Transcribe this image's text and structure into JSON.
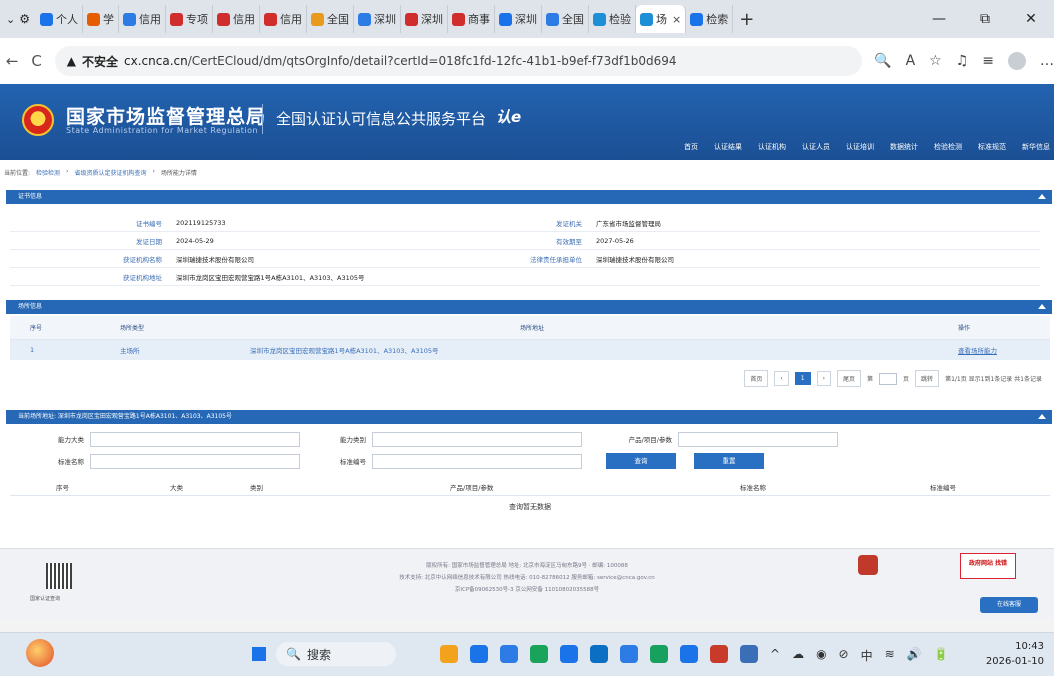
{
  "browser": {
    "tabs": [
      {
        "label": "个人",
        "color": "#1a73e8"
      },
      {
        "label": "学",
        "color": "#e65c00"
      },
      {
        "label": "信用",
        "color": "#2d7be5"
      },
      {
        "label": "专项",
        "color": "#d02d2d"
      },
      {
        "label": "信用",
        "color": "#d02d2d"
      },
      {
        "label": "信用",
        "color": "#d02d2d"
      },
      {
        "label": "全国",
        "color": "#e89a1c"
      },
      {
        "label": "深圳",
        "color": "#2d7be5"
      },
      {
        "label": "深圳",
        "color": "#d02d2d"
      },
      {
        "label": "商事",
        "color": "#d02d2d"
      },
      {
        "label": "深圳",
        "color": "#1a73e8"
      },
      {
        "label": "全国",
        "color": "#2d7be5"
      },
      {
        "label": "检验",
        "color": "#1c8fd6"
      },
      {
        "label": "场",
        "color": "#1c8fd6",
        "active": true
      },
      {
        "label": "检索",
        "color": "#1a73e8"
      }
    ],
    "tab_close": "×",
    "new_tab": "+",
    "window_controls": {
      "minimize": "—",
      "restore": "⧉",
      "close": "✕"
    },
    "back": "←",
    "reload": "C",
    "insecure_label": "不安全",
    "url_host": "cx.cnca.cn",
    "url_path": "/CertECloud/dm/qtsOrgInfo/detail?certId=018fc1fd-12fc-41b1-b9ef-f73df1b0d694",
    "toolbar_icons": [
      "zoom-icon",
      "read-aloud-icon",
      "favorite-icon",
      "extensions-icon",
      "collections-icon",
      "profile-icon",
      "more-icon"
    ],
    "toolbar_glyphs": [
      "🔍",
      "A",
      "☆",
      "♫",
      "≡",
      "",
      "…"
    ]
  },
  "site": {
    "name": "国家市场监督管理总局",
    "name_en": "State Administration for Market Regulation",
    "platform": "全国认证认可信息公共服务平台",
    "platform_logo": "认e",
    "nav": [
      "首页",
      "认证结果",
      "认证机构",
      "认证人员",
      "认证培训",
      "数据统计",
      "检验检测",
      "标准规范",
      "新华信息"
    ]
  },
  "breadcrumb": {
    "prefix": "当前位置:",
    "items": [
      "检验检测",
      "省级资质认定获证机构查询",
      "场所能力详情"
    ]
  },
  "cert_section": {
    "title": "证书信息",
    "rows": [
      {
        "l1": "证书编号",
        "v1": "202119125733",
        "l2": "发证机关",
        "v2": "广东省市场监督管理局"
      },
      {
        "l1": "发证日期",
        "v1": "2024-05-29",
        "l2": "有效期至",
        "v2": "2027-05-26"
      },
      {
        "l1": "获证机构名称",
        "v1": "深圳瑞捷技术股份有限公司",
        "l2": "法律责任承担单位",
        "v2": "深圳瑞捷技术股份有限公司"
      },
      {
        "l1": "获证机构地址",
        "v1": "深圳市龙岗区宝田宏观营宝路1号A栋A3101、A3103、A3105号",
        "l2": "",
        "v2": ""
      }
    ]
  },
  "site_section": {
    "title": "场所信息",
    "headers": {
      "no": "序号",
      "type": "场所类型",
      "addr": "场所地址",
      "op": "操作"
    },
    "rows": [
      {
        "no": "1",
        "type": "主场所",
        "addr": "深圳市龙岗区宝田宏观营宝路1号A栋A3101、A3103、A3105号",
        "op": "查看场所能力"
      }
    ]
  },
  "pager": {
    "first": "首页",
    "prev": "‹",
    "current": "1",
    "next": "›",
    "last": "尾页",
    "goto_prefix": "第",
    "goto_suffix": "页",
    "jump": "跳转",
    "info": "第1/1页 显示1到1条记录 共1条记录"
  },
  "cap_section": {
    "title": "当前场所地址: 深圳市龙岗区宝田宏观营宝路1号A栋A3101、A3103、A3105号",
    "labels": {
      "cap_major": "能力大类",
      "cap_class": "能力类别",
      "product": "产品/项目/参数",
      "std_name": "标准名称",
      "std_no": "标准编号"
    },
    "buttons": {
      "search": "查询",
      "reset": "重置"
    },
    "headers": {
      "no": "序号",
      "major": "大类",
      "class": "类别",
      "product": "产品/项目/参数",
      "std_name": "标准名称",
      "std_no": "标准编号"
    },
    "empty": "查询暂无数据"
  },
  "footer": {
    "qr_label": "国家认证查询",
    "line1": "版权所有: 国家市场监督管理总局  地址: 北京市海淀区马甸东路9号 · 邮编: 100088",
    "line2": "技术支持: 北京中认网络信息技术有限公司  热线电话: 010-82786012  服务邮箱: service@cnca.gov.cn",
    "line3": "京ICP备09062530号-3  京公网安备 11010802035588号",
    "gov_badge": "政府网站 找错",
    "online_service": "在线客服"
  },
  "taskbar": {
    "search_placeholder": "搜索",
    "task_colors": [
      "#f3a21b",
      "#1a73e8",
      "#2d7be5",
      "#1aa35a",
      "#1a73e8",
      "#0b6fc4",
      "#2d7be5",
      "#18a05e",
      "#1a73e8",
      "#c83b2b",
      "#3a6fb8"
    ],
    "tray_glyphs": [
      "^",
      "☁",
      "◉",
      "⊘",
      "中",
      "≋",
      "🔊",
      "🔋"
    ],
    "time": "10:43",
    "date": "2026-01-10"
  }
}
